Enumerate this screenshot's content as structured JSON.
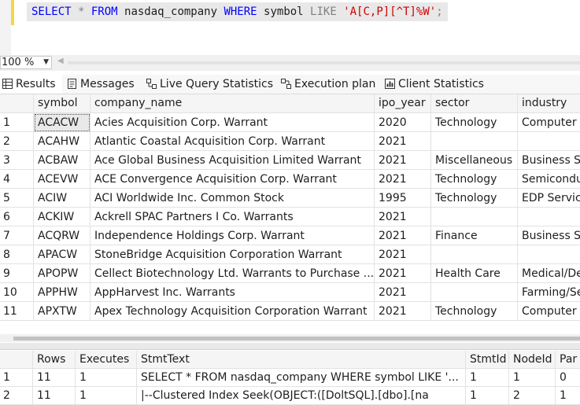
{
  "editor": {
    "query_parts": [
      {
        "t": "SELECT",
        "c": "kw"
      },
      {
        "t": " * ",
        "c": "gr"
      },
      {
        "t": "FROM",
        "c": "kw"
      },
      {
        "t": " nasdaq_company ",
        "c": "id"
      },
      {
        "t": "WHERE",
        "c": "kw"
      },
      {
        "t": " symbol ",
        "c": "id"
      },
      {
        "t": "LIKE",
        "c": "gr"
      },
      {
        "t": " ",
        "c": "id"
      },
      {
        "t": "'A[C,P][^T]%W'",
        "c": "str"
      },
      {
        "t": ";",
        "c": "gr"
      }
    ]
  },
  "zoom": {
    "value": "100 %"
  },
  "tabs": [
    {
      "label": "Results",
      "icon": "grid-icon"
    },
    {
      "label": "Messages",
      "icon": "messages-icon"
    },
    {
      "label": "Live Query Statistics",
      "icon": "live-stats-icon"
    },
    {
      "label": "Execution plan",
      "icon": "execution-plan-icon"
    },
    {
      "label": "Client Statistics",
      "icon": "client-stats-icon"
    }
  ],
  "results": {
    "columns": [
      "symbol",
      "company_name",
      "ipo_year",
      "sector",
      "industry"
    ],
    "rows": [
      [
        "1",
        "ACACW",
        "Acies Acquisition Corp. Warrant",
        "2020",
        "Technology",
        "Computer S"
      ],
      [
        "2",
        "ACAHW",
        "Atlantic Coastal Acquisition Corp. Warrant",
        "2021",
        "",
        ""
      ],
      [
        "3",
        "ACBAW",
        "Ace Global Business Acquisition Limited Warrant",
        "2021",
        "Miscellaneous",
        "Business S"
      ],
      [
        "4",
        "ACEVW",
        "ACE Convergence Acquisition Corp. Warrant",
        "2021",
        "Technology",
        "Semicondu"
      ],
      [
        "5",
        "ACIW",
        "ACI Worldwide Inc. Common Stock",
        "1995",
        "Technology",
        "EDP Servic"
      ],
      [
        "6",
        "ACKIW",
        "Ackrell SPAC Partners I Co. Warrants",
        "2021",
        "",
        ""
      ],
      [
        "7",
        "ACQRW",
        "Independence Holdings Corp. Warrant",
        "2021",
        "Finance",
        "Business S"
      ],
      [
        "8",
        "APACW",
        "StoneBridge Acquisition Corporation Warrant",
        "2021",
        "",
        ""
      ],
      [
        "9",
        "APOPW",
        "Cellect Biotechnology Ltd. Warrants to Purchase ...",
        "2021",
        "Health Care",
        "Medical/De"
      ],
      [
        "10",
        "APPHW",
        "AppHarvest Inc. Warrants",
        "2021",
        "",
        "Farming/Se"
      ],
      [
        "11",
        "APXTW",
        "Apex Technology Acquisition Corporation Warrant",
        "2021",
        "Technology",
        "Computer S"
      ]
    ]
  },
  "plan": {
    "columns": [
      "Rows",
      "Executes",
      "StmtText",
      "StmtId",
      "NodeId",
      "Par"
    ],
    "rows": [
      [
        "1",
        "11",
        "1",
        "SELECT * FROM nasdaq_company WHERE symbol LIKE '...",
        "1",
        "1",
        "0"
      ],
      [
        "2",
        "11",
        "1",
        "  |--Clustered Index Seek(OBJECT:([DoltSQL].[dbo].[na",
        "1",
        "2",
        "1"
      ]
    ]
  }
}
